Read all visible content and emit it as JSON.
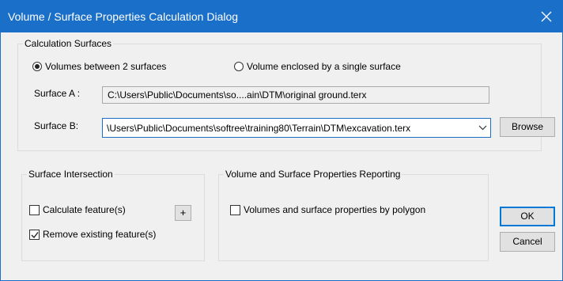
{
  "window": {
    "title": "Volume / Surface Properties Calculation Dialog"
  },
  "calc_surfaces": {
    "legend": "Calculation Surfaces",
    "option_two": "Volumes between 2 surfaces",
    "option_single": "Volume enclosed by a single surface",
    "selected": "option_two",
    "surface_a_label": "Surface A :",
    "surface_a_value": "C:\\Users\\Public\\Documents\\so....ain\\DTM\\original ground.terx",
    "surface_b_label": "Surface B:",
    "surface_b_value": "\\Users\\Public\\Documents\\softree\\training80\\Terrain\\DTM\\excavation.terx",
    "browse_label": "Browse"
  },
  "intersection": {
    "legend": "Surface Intersection",
    "calculate_label": "Calculate feature(s)",
    "calculate_checked": false,
    "plus_label": "+",
    "remove_label": "Remove existing feature(s)",
    "remove_checked": true
  },
  "reporting": {
    "legend": "Volume and Surface Properties Reporting",
    "by_polygon_label": "Volumes and surface properties by polygon",
    "by_polygon_checked": false
  },
  "buttons": {
    "ok": "OK",
    "cancel": "Cancel"
  },
  "icons": {
    "close": "close-icon",
    "dropdown": "chevron-down-icon",
    "check": "checkmark-icon"
  }
}
